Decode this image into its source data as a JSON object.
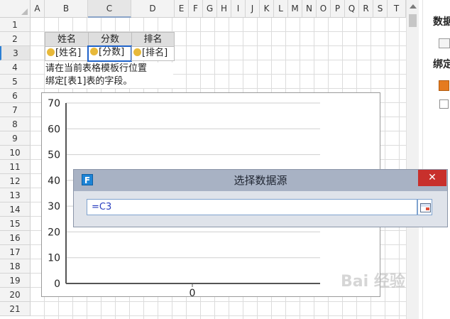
{
  "sheet": {
    "columns": [
      "A",
      "B",
      "C",
      "D",
      "E",
      "F",
      "G",
      "H",
      "I",
      "J",
      "K",
      "L",
      "M",
      "N",
      "O",
      "P",
      "Q",
      "R",
      "S",
      "T"
    ],
    "rows": [
      "1",
      "2",
      "3",
      "4",
      "5",
      "6",
      "7",
      "8",
      "9",
      "10",
      "11",
      "12",
      "13",
      "14",
      "15",
      "16",
      "17",
      "18",
      "19",
      "20",
      "21"
    ],
    "selected_column": "C",
    "selected_row": "3",
    "header_cells": {
      "b2": "姓名",
      "c2": "分数",
      "d2": "排名"
    },
    "data_cells": {
      "b3": "[姓名]",
      "c3": "[分数]",
      "d3": "[排名]"
    },
    "note_line1": "请在当前表格模板行位置",
    "note_line2": "绑定[表1]表的字段。"
  },
  "chart_data": {
    "type": "bar",
    "categories": [
      "0"
    ],
    "values": [
      0
    ],
    "title": "",
    "xlabel": "",
    "ylabel": "",
    "ylim": [
      0,
      70
    ],
    "yticks": [
      0,
      10,
      20,
      30,
      40,
      50,
      60,
      70
    ],
    "grid": true
  },
  "right_panel": {
    "title1": "数据",
    "title2": "绑定"
  },
  "dialog": {
    "logo": "F",
    "title": "选择数据源",
    "close": "✕",
    "input_value": "=C3"
  },
  "watermark": "Bai 经验"
}
